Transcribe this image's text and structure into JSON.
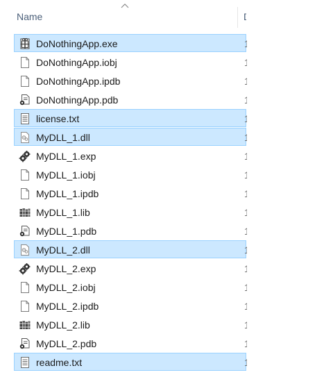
{
  "header": {
    "name_label": "Name",
    "next_col_label": "D",
    "sort_direction": "ascending"
  },
  "files": [
    {
      "name": "DoNothingApp.exe",
      "icon": "exe-icon",
      "selected": true,
      "next_col": "1"
    },
    {
      "name": "DoNothingApp.iobj",
      "icon": "blank-file-icon",
      "selected": false,
      "next_col": "1"
    },
    {
      "name": "DoNothingApp.ipdb",
      "icon": "blank-file-icon",
      "selected": false,
      "next_col": "1"
    },
    {
      "name": "DoNothingApp.pdb",
      "icon": "pdb-file-icon",
      "selected": false,
      "next_col": "1"
    },
    {
      "name": "license.txt",
      "icon": "text-file-icon",
      "selected": true,
      "next_col": "1"
    },
    {
      "name": "MyDLL_1.dll",
      "icon": "dll-file-icon",
      "selected": true,
      "next_col": "1"
    },
    {
      "name": "MyDLL_1.exp",
      "icon": "exp-file-icon",
      "selected": false,
      "next_col": "1"
    },
    {
      "name": "MyDLL_1.iobj",
      "icon": "blank-file-icon",
      "selected": false,
      "next_col": "1"
    },
    {
      "name": "MyDLL_1.ipdb",
      "icon": "blank-file-icon",
      "selected": false,
      "next_col": "1"
    },
    {
      "name": "MyDLL_1.lib",
      "icon": "lib-file-icon",
      "selected": false,
      "next_col": "1"
    },
    {
      "name": "MyDLL_1.pdb",
      "icon": "pdb-file-icon",
      "selected": false,
      "next_col": "1"
    },
    {
      "name": "MyDLL_2.dll",
      "icon": "dll-file-icon",
      "selected": true,
      "next_col": "1"
    },
    {
      "name": "MyDLL_2.exp",
      "icon": "exp-file-icon",
      "selected": false,
      "next_col": "1"
    },
    {
      "name": "MyDLL_2.iobj",
      "icon": "blank-file-icon",
      "selected": false,
      "next_col": "1"
    },
    {
      "name": "MyDLL_2.ipdb",
      "icon": "blank-file-icon",
      "selected": false,
      "next_col": "1"
    },
    {
      "name": "MyDLL_2.lib",
      "icon": "lib-file-icon",
      "selected": false,
      "next_col": "1"
    },
    {
      "name": "MyDLL_2.pdb",
      "icon": "pdb-file-icon",
      "selected": false,
      "next_col": "1"
    },
    {
      "name": "readme.txt",
      "icon": "text-file-icon",
      "selected": true,
      "next_col": "1"
    }
  ],
  "colors": {
    "selection_fill": "#cce8ff",
    "selection_border": "#99d1ff",
    "header_text": "#4c607a"
  }
}
